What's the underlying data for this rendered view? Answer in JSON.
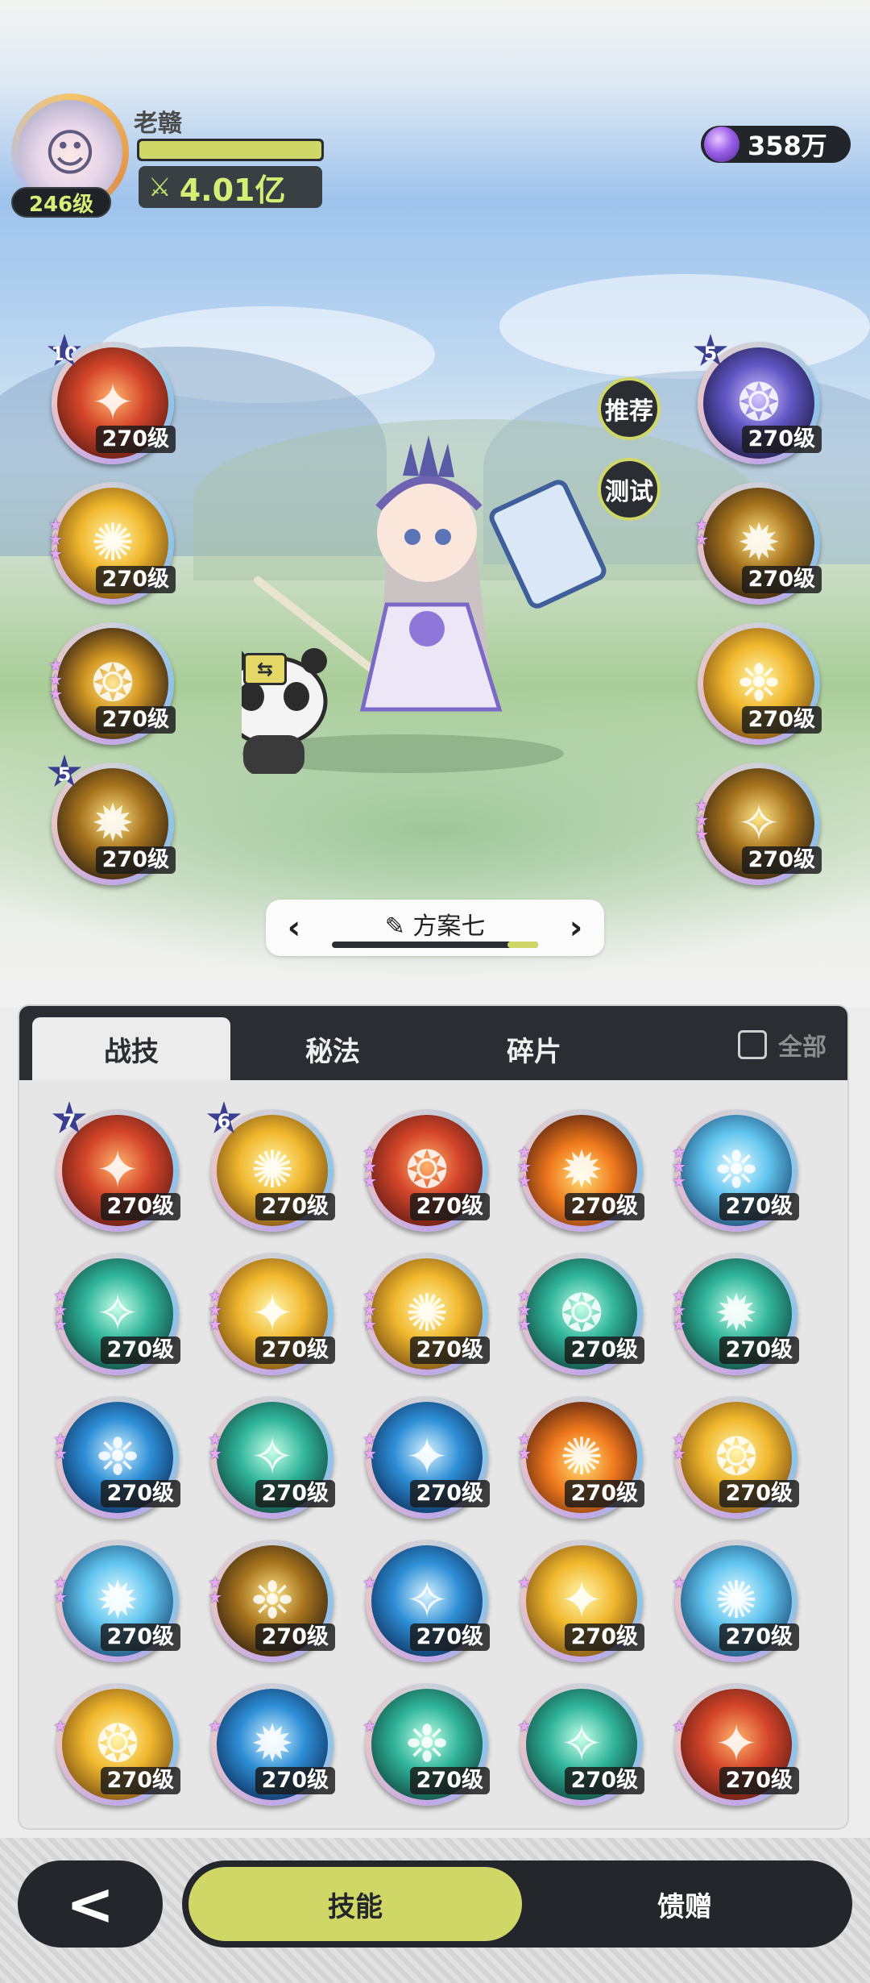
{
  "player": {
    "name": "老赣",
    "level": "246级",
    "power": "4.01亿"
  },
  "currency": {
    "value": "358万"
  },
  "side_buttons": {
    "recommend": "推荐",
    "test": "测试"
  },
  "plan": {
    "name": "方案七",
    "progress_fraction": 0.15
  },
  "equipped_left": [
    {
      "level": "270级",
      "badge": "10",
      "stars": 0,
      "palette": "fire-red",
      "icon": "fire-burst-icon"
    },
    {
      "level": "270级",
      "badge": "",
      "stars": 3,
      "palette": "gold",
      "icon": "star-flash-icon"
    },
    {
      "level": "270级",
      "badge": "",
      "stars": 3,
      "palette": "gold-ring",
      "icon": "light-ring-icon"
    },
    {
      "level": "270级",
      "badge": "5",
      "stars": 0,
      "palette": "gold-dark",
      "icon": "lightning-icon"
    }
  ],
  "equipped_right": [
    {
      "level": "270级",
      "badge": "5",
      "stars": 0,
      "palette": "violet",
      "icon": "arcane-circle-icon"
    },
    {
      "level": "270级",
      "badge": "",
      "stars": 2,
      "palette": "gold-dark",
      "icon": "summon-orb-icon"
    },
    {
      "level": "270级",
      "badge": "",
      "stars": 0,
      "palette": "gold",
      "icon": "shield-figure-icon"
    },
    {
      "level": "270级",
      "badge": "",
      "stars": 3,
      "palette": "gold-dark",
      "icon": "golden-crown-icon"
    }
  ],
  "panel": {
    "tabs": [
      "战技",
      "秘法",
      "碎片"
    ],
    "active_tab": 0,
    "all_label": "全部",
    "skills": [
      {
        "level": "270级",
        "badge": "7",
        "stars": 0,
        "palette": "fire-red",
        "icon": "fire-vortex-icon"
      },
      {
        "level": "270级",
        "badge": "6",
        "stars": 0,
        "palette": "gold",
        "icon": "lightning-orb-icon"
      },
      {
        "level": "270级",
        "badge": "",
        "stars": 3,
        "palette": "fire-red",
        "icon": "meteor-icon"
      },
      {
        "level": "270级",
        "badge": "",
        "stars": 3,
        "palette": "flame",
        "icon": "flame-icon"
      },
      {
        "level": "270级",
        "badge": "",
        "stars": 3,
        "palette": "ice",
        "icon": "ice-crystal-icon"
      },
      {
        "level": "270级",
        "badge": "",
        "stars": 3,
        "palette": "wind",
        "icon": "wind-swirl-icon"
      },
      {
        "level": "270级",
        "badge": "",
        "stars": 3,
        "palette": "gold",
        "icon": "sparkle-stars-icon"
      },
      {
        "level": "270级",
        "badge": "",
        "stars": 3,
        "palette": "gold",
        "icon": "light-burst-icon"
      },
      {
        "level": "270级",
        "badge": "",
        "stars": 3,
        "palette": "wind",
        "icon": "wind-sphere-icon"
      },
      {
        "level": "270级",
        "badge": "",
        "stars": 3,
        "palette": "wind",
        "icon": "wind-arrow-icon"
      },
      {
        "level": "270级",
        "badge": "",
        "stars": 2,
        "palette": "water",
        "icon": "water-wave-icon"
      },
      {
        "level": "270级",
        "badge": "",
        "stars": 2,
        "palette": "wind",
        "icon": "green-vortex-icon"
      },
      {
        "level": "270级",
        "badge": "",
        "stars": 2,
        "palette": "water",
        "icon": "whirlpool-icon"
      },
      {
        "level": "270级",
        "badge": "",
        "stars": 2,
        "palette": "flame",
        "icon": "fire-blast-icon"
      },
      {
        "level": "270级",
        "badge": "",
        "stars": 2,
        "palette": "gold",
        "icon": "solar-flare-icon"
      },
      {
        "level": "270级",
        "badge": "",
        "stars": 2,
        "palette": "ice",
        "icon": "ice-splash-icon"
      },
      {
        "level": "270级",
        "badge": "",
        "stars": 2,
        "palette": "gold-dark",
        "icon": "golden-crystal-icon"
      },
      {
        "level": "270级",
        "badge": "",
        "stars": 1,
        "palette": "water",
        "icon": "ice-orb-icon"
      },
      {
        "level": "270级",
        "badge": "",
        "stars": 1,
        "palette": "gold",
        "icon": "sunburst-icon"
      },
      {
        "level": "270级",
        "badge": "",
        "stars": 1,
        "palette": "ice",
        "icon": "ice-spikes-icon"
      },
      {
        "level": "270级",
        "badge": "",
        "stars": 1,
        "palette": "gold",
        "icon": "holy-beam-icon"
      },
      {
        "level": "270级",
        "badge": "",
        "stars": 1,
        "palette": "water",
        "icon": "blue-flame-icon"
      },
      {
        "level": "270级",
        "badge": "",
        "stars": 1,
        "palette": "wind",
        "icon": "thorn-vine-icon"
      },
      {
        "level": "270级",
        "badge": "",
        "stars": 1,
        "palette": "wind",
        "icon": "tornado-icon"
      },
      {
        "level": "270级",
        "badge": "",
        "stars": 1,
        "palette": "fire-red",
        "icon": "red-flame-icon"
      }
    ]
  },
  "nav": {
    "back_label": "<",
    "skill_label": "技能",
    "gift_label": "馈赠"
  },
  "colors": {
    "accent": "#cfd767",
    "dark": "#2a2e32"
  }
}
